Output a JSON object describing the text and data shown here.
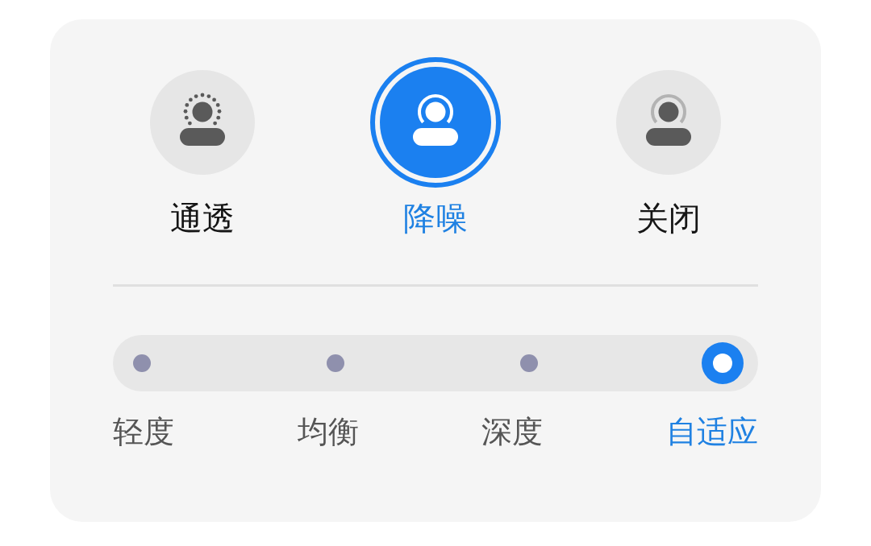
{
  "modes": [
    {
      "label": "通透",
      "kind": "dotted",
      "selected": false
    },
    {
      "label": "降噪",
      "kind": "ring",
      "selected": true
    },
    {
      "label": "关闭",
      "kind": "faded",
      "selected": false
    }
  ],
  "levels": [
    {
      "label": "轻度",
      "selected": false
    },
    {
      "label": "均衡",
      "selected": false
    },
    {
      "label": "深度",
      "selected": false
    },
    {
      "label": "自适应",
      "selected": true
    }
  ]
}
